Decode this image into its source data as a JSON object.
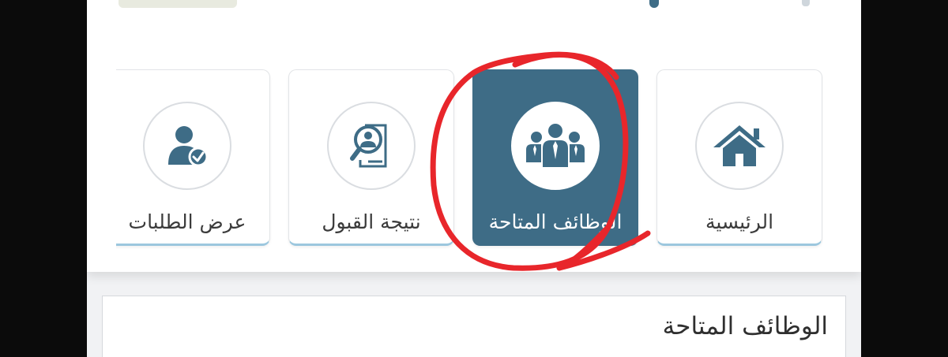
{
  "nav": {
    "items": [
      {
        "label": "الرئيسية",
        "icon": "home-icon",
        "active": false
      },
      {
        "label": "الوظائف المتاحة",
        "icon": "team-icon",
        "active": true
      },
      {
        "label": "نتيجة القبول",
        "icon": "search-document-icon",
        "active": false
      },
      {
        "label": "عرض الطلبات",
        "icon": "user-check-icon",
        "active": false
      }
    ]
  },
  "section": {
    "title": "الوظائف المتاحة"
  },
  "colors": {
    "accent": "#3e6c86",
    "annotation": "#e8262b",
    "tile_underline": "#9cc7de"
  }
}
